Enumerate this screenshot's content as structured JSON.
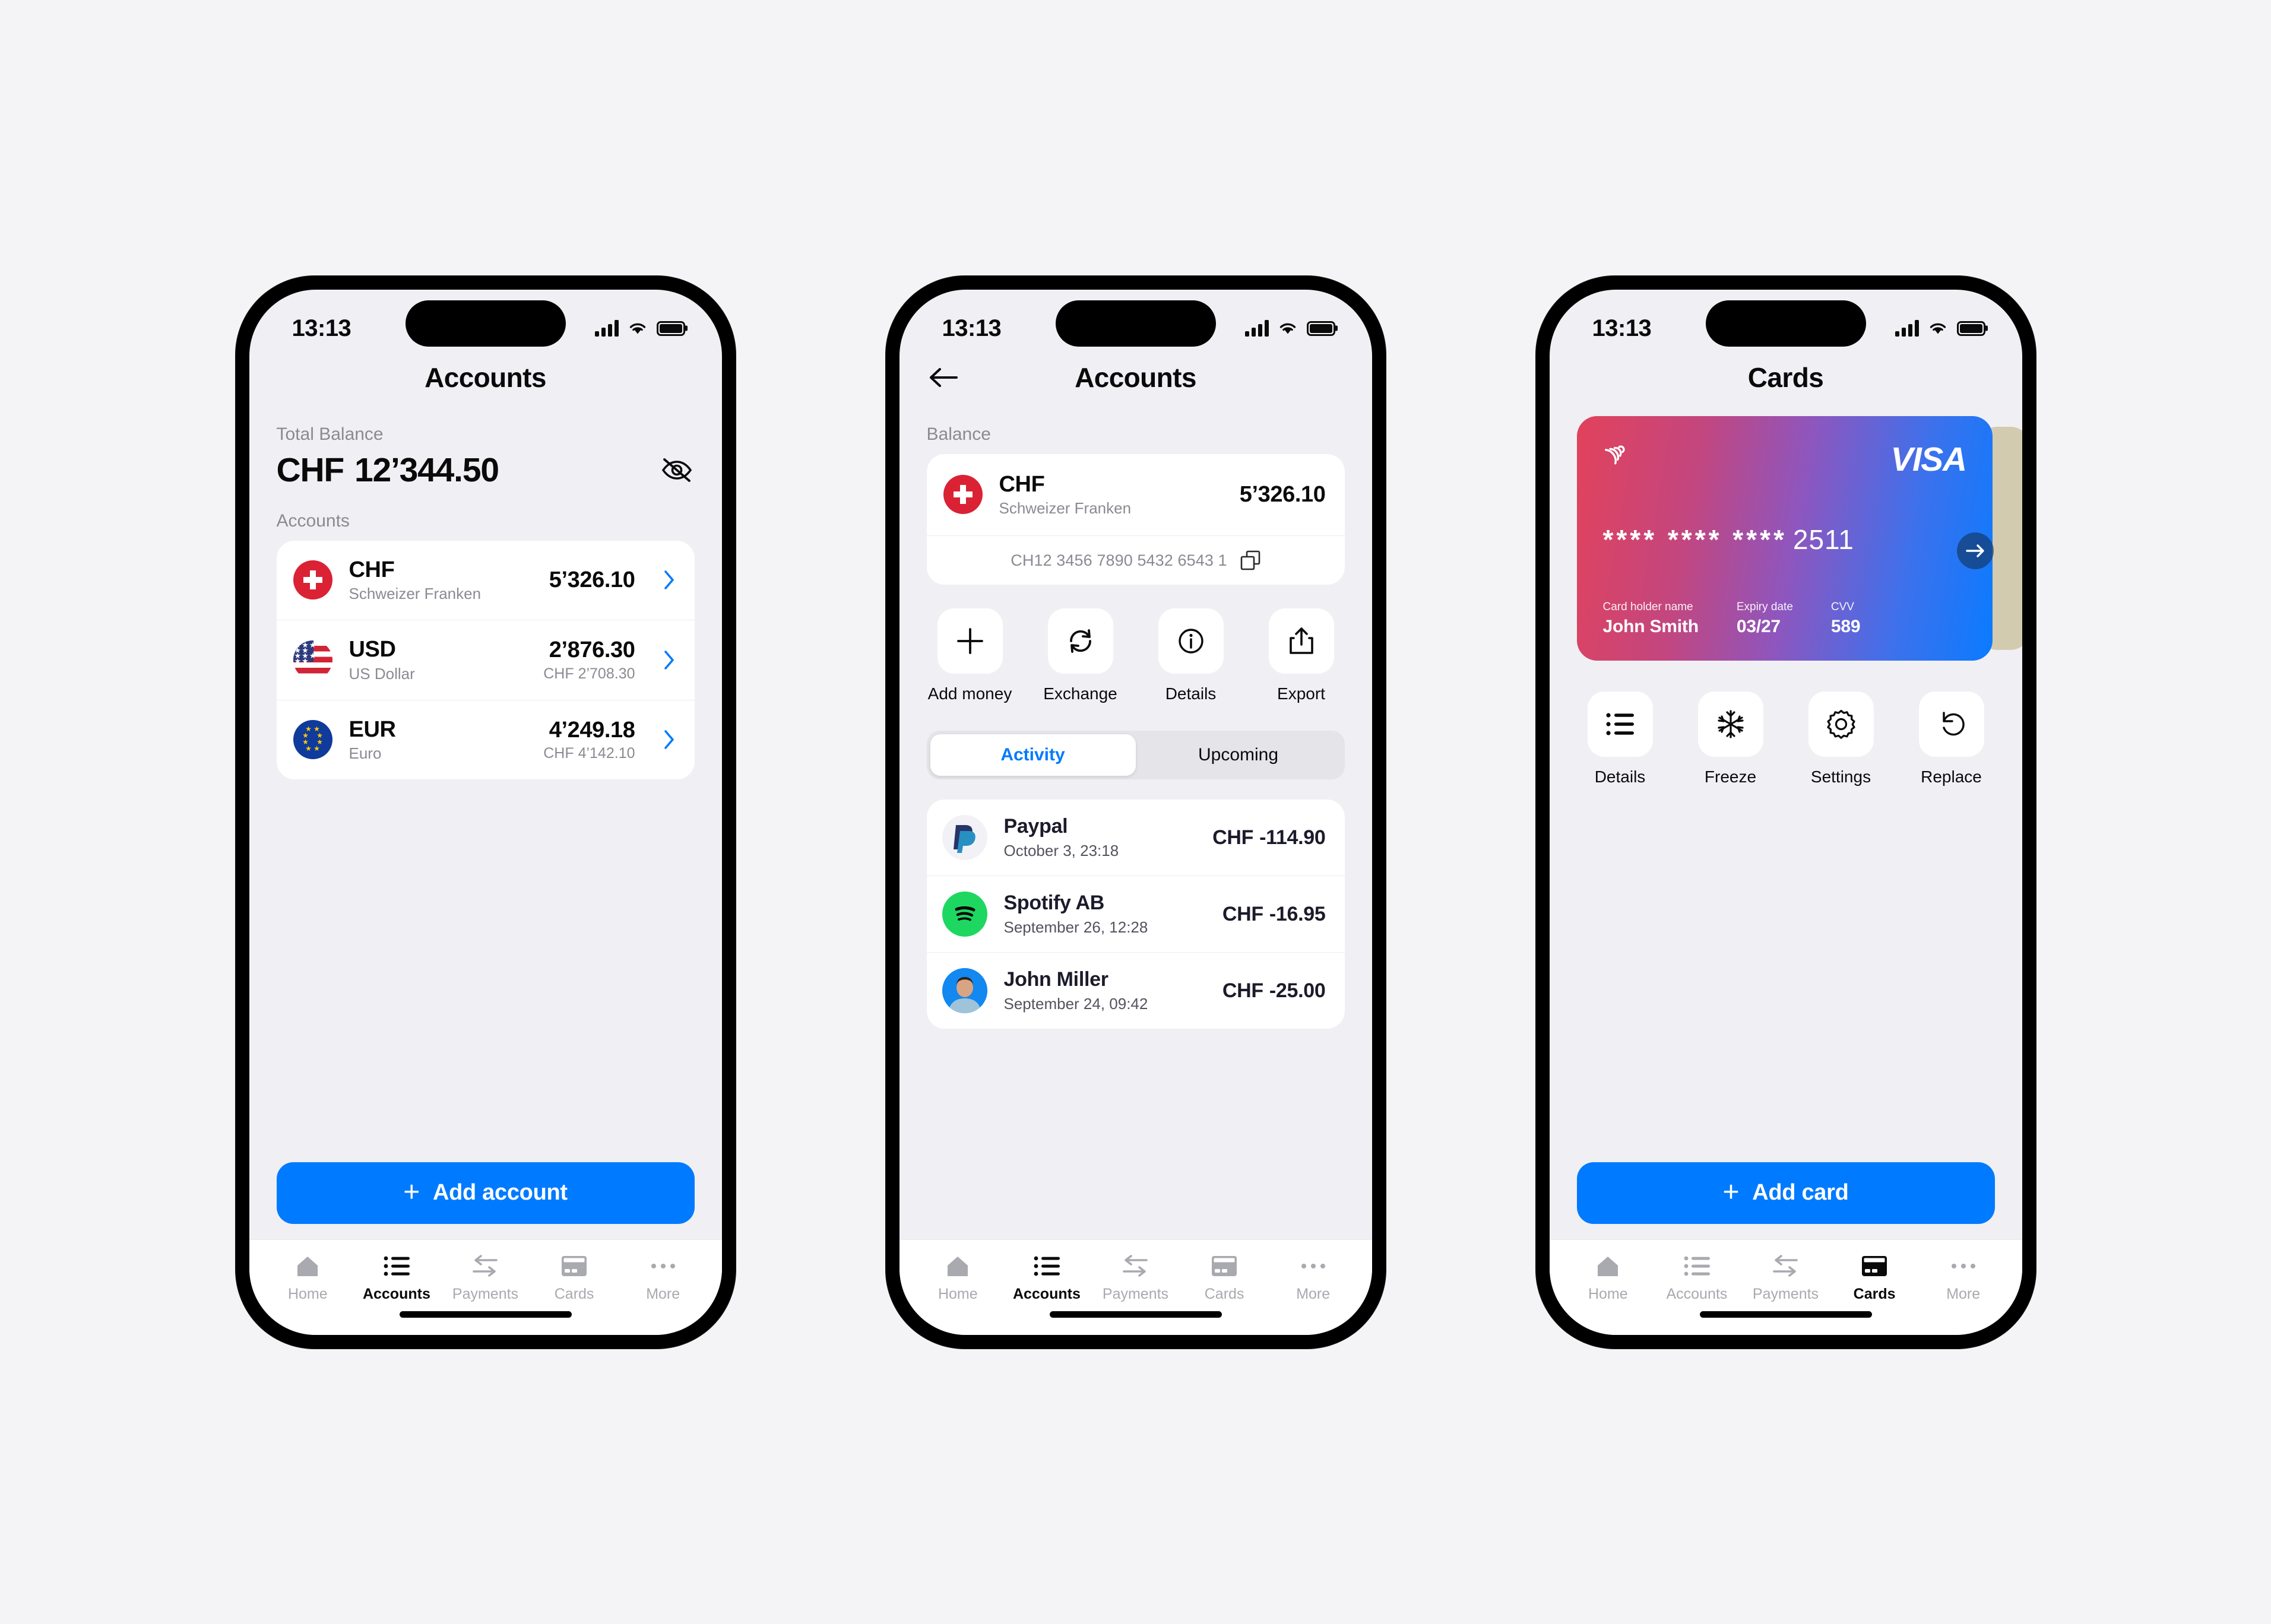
{
  "statusbar": {
    "time": "13:13"
  },
  "phone1": {
    "nav_title": "Accounts",
    "total_label": "Total Balance",
    "total_currency": "CHF",
    "total_amount": "12’344.50",
    "accounts_label": "Accounts",
    "accounts": [
      {
        "code": "CHF",
        "name": "Schweizer Franken",
        "amount": "5’326.10",
        "converted": ""
      },
      {
        "code": "USD",
        "name": "US Dollar",
        "amount": "2’876.30",
        "converted": "CHF 2’708.30"
      },
      {
        "code": "EUR",
        "name": "Euro",
        "amount": "4’249.18",
        "converted": "CHF 4’142.10"
      }
    ],
    "cta_label": "Add account",
    "tabs": [
      {
        "label": "Home",
        "icon": "home-icon",
        "active": false
      },
      {
        "label": "Accounts",
        "icon": "list-icon",
        "active": true
      },
      {
        "label": "Payments",
        "icon": "transfer-arrows-icon",
        "active": false
      },
      {
        "label": "Cards",
        "icon": "card-icon",
        "active": false
      },
      {
        "label": "More",
        "icon": "ellipsis-icon",
        "active": false
      }
    ]
  },
  "phone2": {
    "nav_title": "Accounts",
    "balance_label": "Balance",
    "account": {
      "code": "CHF",
      "name": "Schweizer Franken",
      "amount": "5’326.10",
      "iban": "CH12 3456 7890 5432 6543 1"
    },
    "actions": [
      {
        "label": "Add money",
        "icon": "plus-icon"
      },
      {
        "label": "Exchange",
        "icon": "exchange-refresh-icon"
      },
      {
        "label": "Details",
        "icon": "info-circle-icon"
      },
      {
        "label": "Export",
        "icon": "share-export-icon"
      }
    ],
    "segments": [
      {
        "label": "Activity",
        "active": true
      },
      {
        "label": "Upcoming",
        "active": false
      }
    ],
    "transactions": [
      {
        "name": "Paypal",
        "date": "October 3, 23:18",
        "currency": "CHF",
        "amount": "-114.90",
        "avatar": "paypal-logo"
      },
      {
        "name": "Spotify AB",
        "date": "September 26, 12:28",
        "currency": "CHF",
        "amount": "-16.95",
        "avatar": "spotify-logo"
      },
      {
        "name": "John Miller",
        "date": "September 24, 09:42",
        "currency": "CHF",
        "amount": "-25.00",
        "avatar": "person-photo"
      }
    ],
    "tabs": [
      {
        "label": "Home",
        "icon": "home-icon",
        "active": false
      },
      {
        "label": "Accounts",
        "icon": "list-icon",
        "active": true
      },
      {
        "label": "Payments",
        "icon": "transfer-arrows-icon",
        "active": false
      },
      {
        "label": "Cards",
        "icon": "card-icon",
        "active": false
      },
      {
        "label": "More",
        "icon": "ellipsis-icon",
        "active": false
      }
    ]
  },
  "phone3": {
    "nav_title": "Cards",
    "card": {
      "brand": "VISA",
      "number_masked": "**** **** ****",
      "number_last4": "2511",
      "holder_label": "Card holder name",
      "holder_value": "John Smith",
      "expiry_label": "Expiry date",
      "expiry_value": "03/27",
      "cvv_label": "CVV",
      "cvv_value": "589",
      "gradient_from": "#E2425B",
      "gradient_to": "#0A7BFF"
    },
    "actions": [
      {
        "label": "Details",
        "icon": "list-icon"
      },
      {
        "label": "Freeze",
        "icon": "snowflake-icon"
      },
      {
        "label": "Settings",
        "icon": "gear-icon"
      },
      {
        "label": "Replace",
        "icon": "undo-arrow-icon"
      }
    ],
    "cta_label": "Add card",
    "tabs": [
      {
        "label": "Home",
        "icon": "home-icon",
        "active": false
      },
      {
        "label": "Accounts",
        "icon": "list-icon",
        "active": false
      },
      {
        "label": "Payments",
        "icon": "transfer-arrows-icon",
        "active": false
      },
      {
        "label": "Cards",
        "icon": "card-icon",
        "active": true
      },
      {
        "label": "More",
        "icon": "ellipsis-icon",
        "active": false
      }
    ]
  },
  "colors": {
    "accent": "#007AFF",
    "background": "#F0F0F4",
    "surface": "#FFFFFF",
    "muted": "#8A8A92"
  }
}
